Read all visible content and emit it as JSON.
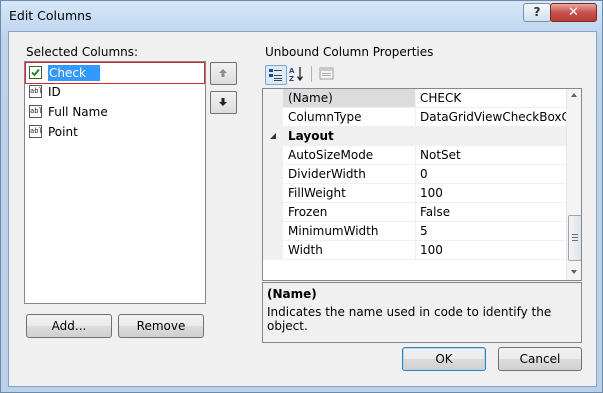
{
  "window": {
    "title": "Edit Columns",
    "help_label": "?",
    "close_label": "✕"
  },
  "left": {
    "label": "Selected Columns:",
    "items": [
      {
        "label": "Check",
        "icon": "checkbox-column-icon",
        "selected": true
      },
      {
        "label": "ID",
        "icon": "textbox-column-icon",
        "icon_text": "abl"
      },
      {
        "label": "Full Name",
        "icon": "textbox-column-icon",
        "icon_text": "abl"
      },
      {
        "label": "Point",
        "icon": "textbox-column-icon",
        "icon_text": "abl"
      }
    ],
    "add_label": "Add...",
    "remove_label": "Remove"
  },
  "right": {
    "label": "Unbound Column Properties",
    "properties": [
      {
        "name": "(Name)",
        "value": "CHECK",
        "type": "prop",
        "selected": true
      },
      {
        "name": "ColumnType",
        "value": "DataGridViewCheckBoxColu",
        "type": "prop"
      },
      {
        "name": "Layout",
        "value": "",
        "type": "category"
      },
      {
        "name": "AutoSizeMode",
        "value": "NotSet",
        "type": "prop"
      },
      {
        "name": "DividerWidth",
        "value": "0",
        "type": "prop"
      },
      {
        "name": "FillWeight",
        "value": "100",
        "type": "prop"
      },
      {
        "name": "Frozen",
        "value": "False",
        "type": "prop"
      },
      {
        "name": "MinimumWidth",
        "value": "5",
        "type": "prop"
      },
      {
        "name": "Width",
        "value": "100",
        "type": "prop"
      }
    ],
    "description": {
      "title": "(Name)",
      "text": "Indicates the name used in code to identify the object."
    }
  },
  "buttons": {
    "ok_label": "OK",
    "cancel_label": "Cancel"
  },
  "colors": {
    "selection": "#3399ff",
    "selection_border": "#d4282e",
    "title_gradient_top": "#d6e7f9",
    "close_button": "#c75050"
  }
}
